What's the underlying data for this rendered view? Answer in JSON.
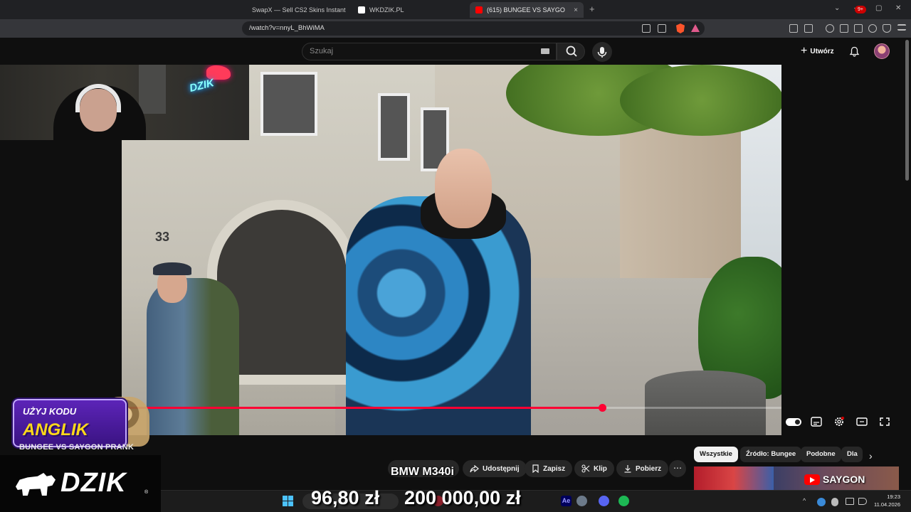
{
  "browser": {
    "tabs": [
      {
        "label": "SwapX — Sell CS2 Skins Instantly for",
        "active": false
      },
      {
        "label": "WKDZIK.PL",
        "active": false
      },
      {
        "label": "(615) BUNGEE VS SAYGON PRAN",
        "active": true
      }
    ],
    "close_glyph": "×",
    "new_tab_glyph": "+",
    "url": "/watch?v=nnyL_BhWiMA"
  },
  "youtube": {
    "search_placeholder": "Szukaj",
    "create_label": "Utwórz",
    "notification_badge": "9+"
  },
  "player": {
    "progress": 0.767
  },
  "video_overlay": {
    "building_number": "33",
    "plate_text": "BMW M340i"
  },
  "stream_overlay": {
    "neon_sign": "DZIK",
    "promo_line1": "UŻYJ KODU",
    "promo_code": "ANGLIK",
    "video_title": "BUNGEE VS SAYGON PRANK",
    "brand": "DZIK",
    "brand_mark": "®",
    "money_left": "96,80 zł",
    "money_right": "200 000,00 zł"
  },
  "actions": {
    "share_label": "Udostępnij",
    "save_label": "Zapisz",
    "clip_label": "Klip",
    "download_label": "Pobierz",
    "more_glyph": "⋯"
  },
  "chips": {
    "items": [
      "Wszystkie",
      "Źródło: Bungee",
      "Podobne",
      "Dla"
    ],
    "next_glyph": "›"
  },
  "related": {
    "channel_text": "SAYGON"
  },
  "taskbar": {
    "time": "19:23",
    "date": "11.04.2026",
    "ae_label": "Ae",
    "tray_chevron": "^"
  },
  "colors": {
    "youtube_red": "#ff0033",
    "promo_purple": "#5c24b8",
    "promo_yellow": "#ffd91a",
    "background": "#0f0f0f"
  }
}
